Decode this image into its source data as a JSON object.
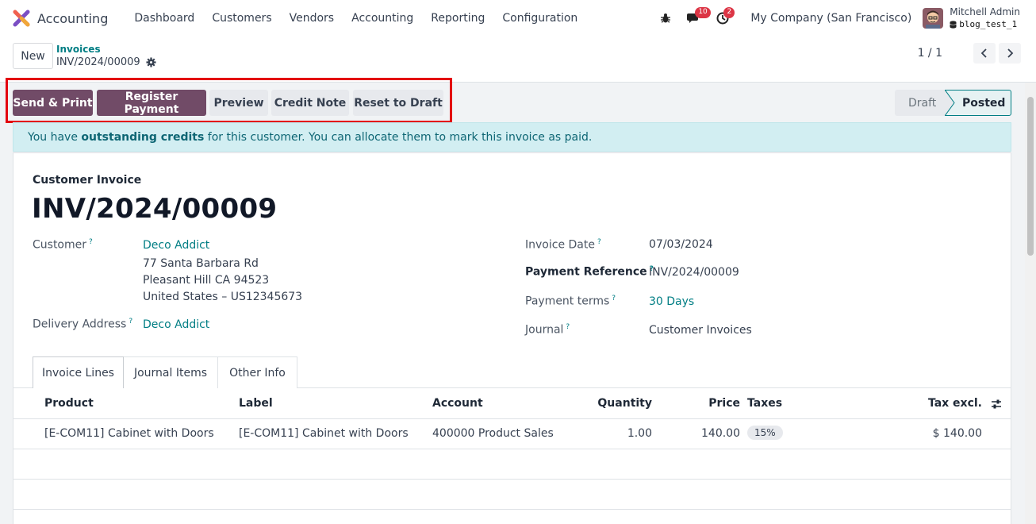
{
  "navbar": {
    "app_name": "Accounting",
    "menu": [
      "Dashboard",
      "Customers",
      "Vendors",
      "Accounting",
      "Reporting",
      "Configuration"
    ],
    "messages_count": "10",
    "activities_count": "2",
    "company": "My Company (San Francisco)",
    "user_name": "Mitchell Admin",
    "db_name": "blog_test_1"
  },
  "control_panel": {
    "new_label": "New",
    "breadcrumb_parent": "Invoices",
    "breadcrumb_current": "INV/2024/00009",
    "pager": "1 / 1"
  },
  "status_bar": {
    "actions": {
      "send_print": "Send & Print",
      "register_payment": "Register Payment",
      "preview": "Preview",
      "credit_note": "Credit Note",
      "reset_to_draft": "Reset to Draft"
    },
    "stages": {
      "draft": "Draft",
      "posted": "Posted"
    }
  },
  "alert": {
    "prefix": "You have ",
    "strong": "outstanding credits",
    "suffix": " for this customer. You can allocate them to mark this invoice as paid."
  },
  "invoice": {
    "move_type": "Customer Invoice",
    "name": "INV/2024/00009",
    "customer_label": "Customer",
    "customer_name": "Deco Addict",
    "address_line1": "77 Santa Barbara Rd",
    "address_line2": "Pleasant Hill CA 94523",
    "address_line3": "United States – US12345673",
    "delivery_label": "Delivery Address",
    "delivery_value": "Deco Addict",
    "invoice_date_label": "Invoice Date",
    "invoice_date": "07/03/2024",
    "payment_ref_label": "Payment Reference",
    "payment_ref": "INV/2024/00009",
    "payment_terms_label": "Payment terms",
    "payment_terms": "30 Days",
    "journal_label": "Journal",
    "journal": "Customer Invoices",
    "help_mark": "?"
  },
  "tabs": {
    "invoice_lines": "Invoice Lines",
    "journal_items": "Journal Items",
    "other_info": "Other Info"
  },
  "table": {
    "headers": {
      "product": "Product",
      "label": "Label",
      "account": "Account",
      "quantity": "Quantity",
      "price": "Price",
      "taxes": "Taxes",
      "tax_excl": "Tax excl."
    },
    "rows": [
      {
        "product": "[E-COM11] Cabinet with Doors",
        "label": "[E-COM11] Cabinet with Doors",
        "account": "400000 Product Sales",
        "quantity": "1.00",
        "price": "140.00",
        "taxes": "15%",
        "tax_excl": "$ 140.00"
      }
    ]
  },
  "colors": {
    "primary": "#714b67",
    "link": "#017e84",
    "highlight": "#e3000f"
  }
}
